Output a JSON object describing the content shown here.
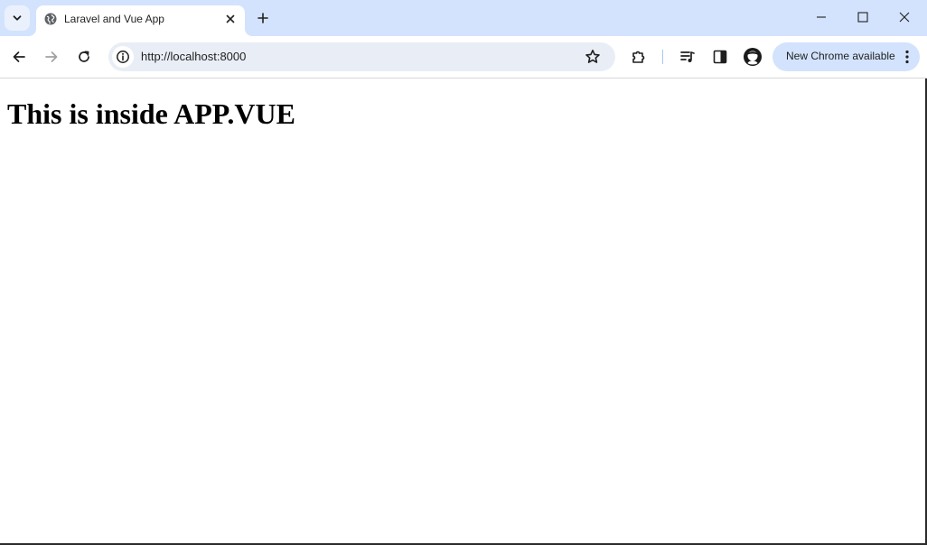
{
  "browser": {
    "tab": {
      "title": "Laravel and Vue App",
      "favicon": "globe-icon"
    },
    "address_bar": {
      "url": "http://localhost:8000"
    },
    "update_chip": {
      "label": "New Chrome available"
    },
    "icons": {
      "tab_search": "chevron-down-icon",
      "tab_close": "close-icon",
      "new_tab": "plus-icon",
      "minimize": "minimize-icon",
      "maximize": "maximize-icon",
      "close_window": "close-window-icon",
      "back": "back-arrow-icon",
      "forward": "forward-arrow-icon",
      "reload": "reload-icon",
      "site_info": "info-icon",
      "bookmark": "star-icon",
      "extensions": "puzzle-icon",
      "media": "media-queue-icon",
      "side_panel": "side-panel-icon",
      "profile": "avatar-icon",
      "more": "kebab-menu-icon"
    },
    "colors": {
      "tabstrip_bg": "#d3e3fd",
      "omnibox_bg": "#e9eef6",
      "chip_bg": "#d3e3fd"
    }
  },
  "page": {
    "heading": "This is inside APP.VUE"
  }
}
